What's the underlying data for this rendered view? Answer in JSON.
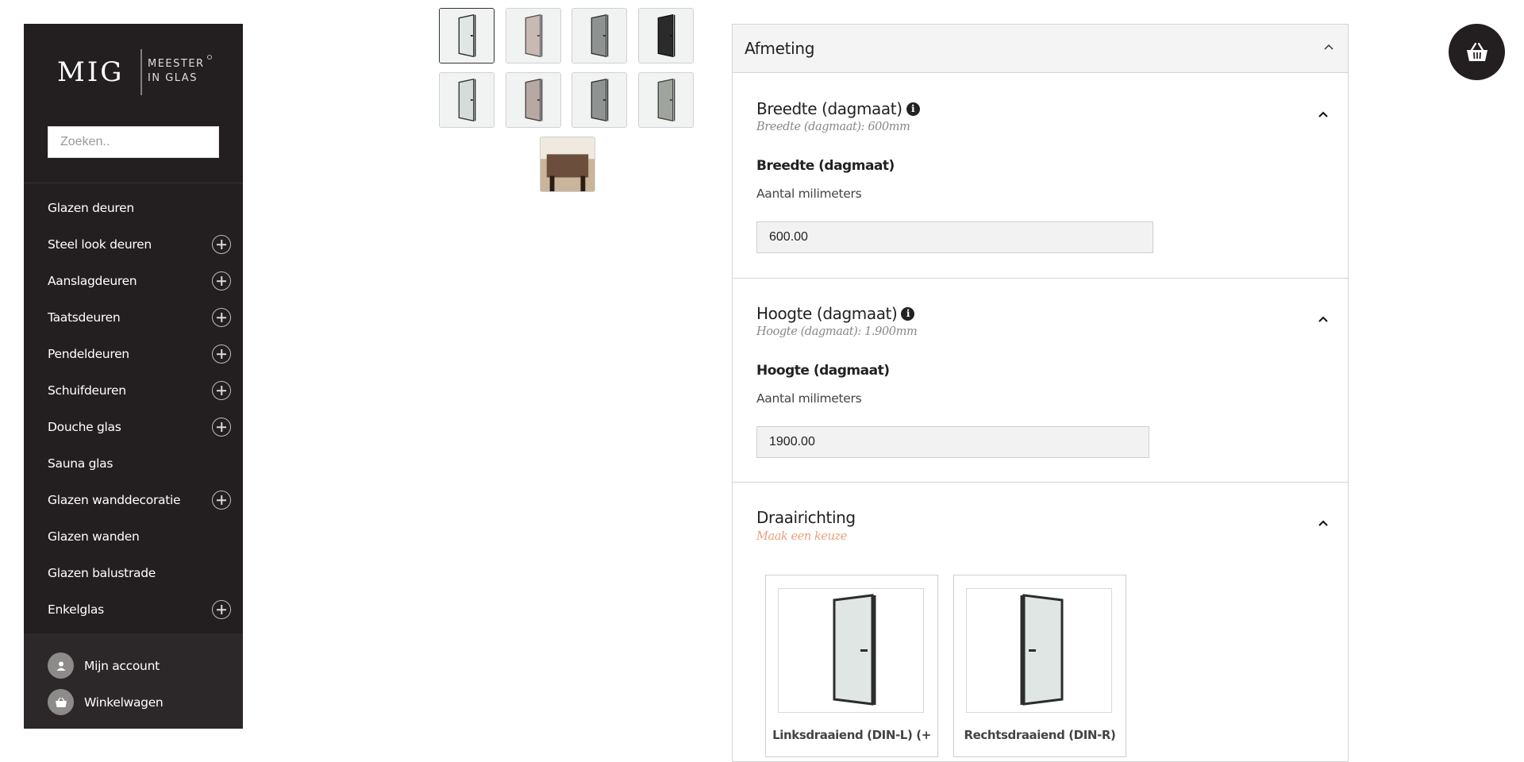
{
  "sidebar": {
    "logo": {
      "mark": "MIG",
      "line1": "MEESTER",
      "line2": "IN GLAS"
    },
    "search": {
      "placeholder": "Zoeken.."
    },
    "items": [
      {
        "label": "Glazen deuren",
        "expandable": false
      },
      {
        "label": "Steel look deuren",
        "expandable": true
      },
      {
        "label": "Aanslagdeuren",
        "expandable": true
      },
      {
        "label": "Taatsdeuren",
        "expandable": true
      },
      {
        "label": "Pendeldeuren",
        "expandable": true
      },
      {
        "label": "Schuifdeuren",
        "expandable": true
      },
      {
        "label": "Douche glas",
        "expandable": true
      },
      {
        "label": "Sauna glas",
        "expandable": false
      },
      {
        "label": "Glazen wanddecoratie",
        "expandable": true
      },
      {
        "label": "Glazen wanden",
        "expandable": false
      },
      {
        "label": "Glazen balustrade",
        "expandable": false
      },
      {
        "label": "Enkelglas",
        "expandable": true
      }
    ],
    "account": {
      "label": "Mijn account",
      "icon": "user-icon"
    },
    "cart": {
      "label": "Winkelwagen",
      "icon": "basket-icon"
    }
  },
  "gallery": {
    "thumbs": [
      {
        "tint": "#dfe6e3",
        "frame": "#2a2a2a",
        "active": true
      },
      {
        "tint": "#c9b9b4",
        "frame": "#555",
        "active": false
      },
      {
        "tint": "#8e9290",
        "frame": "#333",
        "active": false
      },
      {
        "tint": "#2b2b2b",
        "frame": "#111",
        "active": false
      },
      {
        "tint": "#d5dcd9",
        "frame": "#333",
        "active": false
      },
      {
        "tint": "#b8a8a3",
        "frame": "#444",
        "active": false
      },
      {
        "tint": "#8f9391",
        "frame": "#333",
        "active": false
      },
      {
        "tint": "#9fa49f",
        "frame": "#444",
        "active": false
      },
      {
        "tint": "#6b4f3c",
        "frame": "#2d1c12",
        "active": false
      }
    ]
  },
  "panel": {
    "title": "Afmeting",
    "width_option": {
      "title": "Breedte (dagmaat)",
      "subtitle": "Breedte (dagmaat): 600mm",
      "field_label": "Breedte (dagmaat)",
      "hint": "Aantal milimeters",
      "value": "600.00"
    },
    "height_option": {
      "title": "Hoogte (dagmaat)",
      "subtitle": "Hoogte (dagmaat): 1.900mm",
      "field_label": "Hoogte (dagmaat)",
      "hint": "Aantal milimeters",
      "value": "1900.00"
    },
    "direction_option": {
      "title": "Draairichting",
      "subtitle": "Maak een keuze",
      "choices": [
        {
          "label": "Linksdraaiend (DIN-L) (+"
        },
        {
          "label": "Rechtsdraaiend (DIN-R)"
        }
      ]
    }
  },
  "colors": {
    "sidebar_bg": "#231f20",
    "warn": "#e8a07a"
  }
}
